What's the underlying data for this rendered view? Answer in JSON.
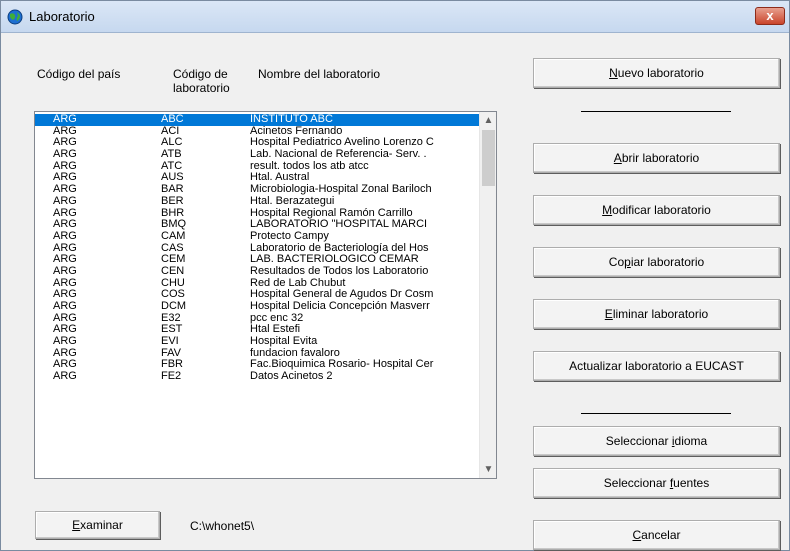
{
  "window": {
    "title": "Laboratorio",
    "close_label": "x"
  },
  "headers": {
    "country": "Código del país",
    "code_line1": "Código de",
    "code_line2": "laboratorio",
    "name": "Nombre del laboratorio"
  },
  "rows": [
    [
      "ARG",
      "ABC",
      "INSTITUTO ABC"
    ],
    [
      "ARG",
      "ACI",
      "Acinetos Fernando"
    ],
    [
      "ARG",
      "ALC",
      "Hospital Pediatrico Avelino Lorenzo C"
    ],
    [
      "ARG",
      "ATB",
      "Lab. Nacional  de Referencia- Serv. ."
    ],
    [
      "ARG",
      "ATC",
      "result. todos los atb atcc"
    ],
    [
      "ARG",
      "AUS",
      "Htal. Austral"
    ],
    [
      "ARG",
      "BAR",
      "Microbiologia-Hospital Zonal Bariloch"
    ],
    [
      "ARG",
      "BER",
      "Htal. Berazategui"
    ],
    [
      "ARG",
      "BHR",
      "Hospital Regional Ramón Carrillo"
    ],
    [
      "ARG",
      "BMQ",
      "LABORATORIO \"HOSPITAL MARCI"
    ],
    [
      "ARG",
      "CAM",
      "Protecto Campy"
    ],
    [
      "ARG",
      "CAS",
      "Laboratorio de Bacteriología del Hos"
    ],
    [
      "ARG",
      "CEM",
      "LAB. BACTERIOLOGICO CEMAR"
    ],
    [
      "ARG",
      "CEN",
      "Resultados de Todos los Laboratorio"
    ],
    [
      "ARG",
      "CHU",
      "Red de Lab Chubut"
    ],
    [
      "ARG",
      "COS",
      "Hospital General de Agudos Dr Cosm"
    ],
    [
      "ARG",
      "DCM",
      "Hospital Delicia Concepción Masverr"
    ],
    [
      "ARG",
      "E32",
      "pcc enc 32"
    ],
    [
      "ARG",
      "EST",
      "Htal Estefi"
    ],
    [
      "ARG",
      "EVI",
      "Hospital Evita"
    ],
    [
      "ARG",
      "FAV",
      "fundacion favaloro"
    ],
    [
      "ARG",
      "FBR",
      "Fac.Bioquimica Rosario- Hospital Cer"
    ],
    [
      "ARG",
      "FE2",
      "Datos Acinetos 2"
    ]
  ],
  "selected_row": 0,
  "buttons": {
    "new_lab": {
      "pre": "",
      "u": "N",
      "post": "uevo laboratorio"
    },
    "open_lab": {
      "pre": "",
      "u": "A",
      "post": "brir laboratorio"
    },
    "modify_lab": {
      "pre": "",
      "u": "M",
      "post": "odificar laboratorio"
    },
    "copy_lab": {
      "pre": "Co",
      "u": "p",
      "post": "iar laboratorio"
    },
    "delete_lab": {
      "pre": "",
      "u": "E",
      "post": "liminar laboratorio"
    },
    "update_eucast": {
      "pre": "Actualizar laboratorio a EUCAST",
      "u": "",
      "post": ""
    },
    "select_language": {
      "pre": "Seleccionar ",
      "u": "i",
      "post": "dioma"
    },
    "select_sources": {
      "pre": "Seleccionar ",
      "u": "f",
      "post": "uentes"
    },
    "cancel": {
      "pre": "",
      "u": "C",
      "post": "ancelar"
    },
    "browse": {
      "pre": "",
      "u": "E",
      "post": "xaminar"
    }
  },
  "path": "C:\\whonet5\\",
  "icons": {
    "app": "globe-icon",
    "scroll_up": "scroll-up-arrow-icon",
    "scroll_down": "scroll-down-arrow-icon"
  }
}
